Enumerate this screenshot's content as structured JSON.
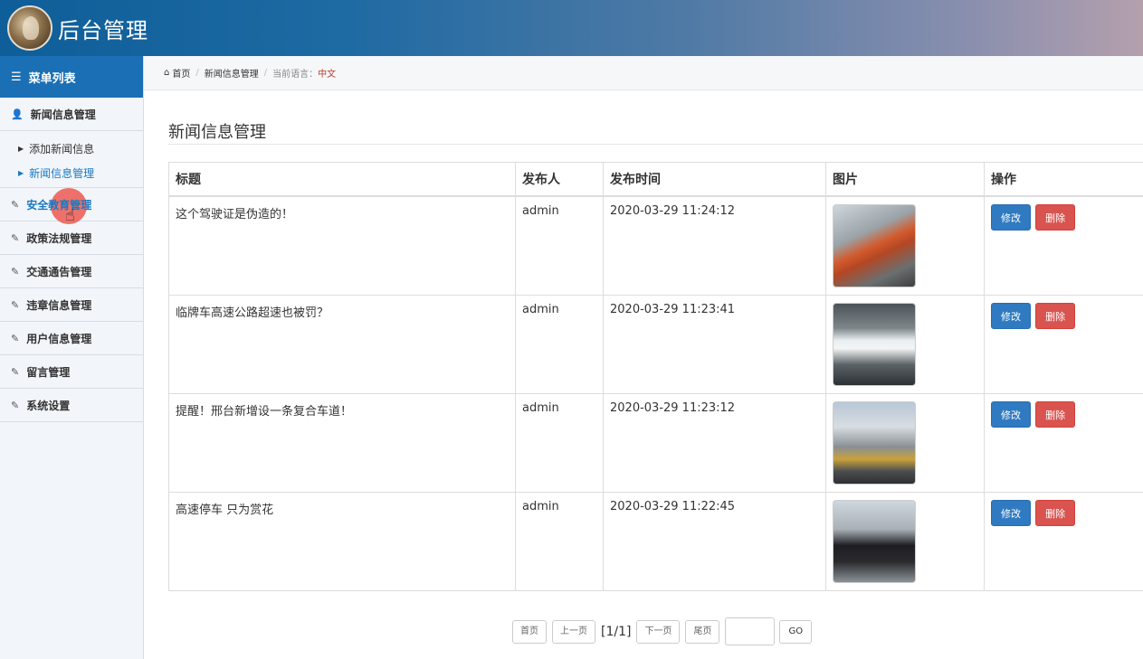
{
  "header": {
    "title": "后台管理",
    "avatar": "avatar-image"
  },
  "sidebar": {
    "menu_title": "菜单列表",
    "menu_icon": "list-icon",
    "group": {
      "title": "新闻信息管理",
      "icon": "user-icon",
      "items": [
        {
          "label": "添加新闻信息",
          "active": false
        },
        {
          "label": "新闻信息管理",
          "active": true
        }
      ]
    },
    "items": [
      {
        "label": "安全教育管理",
        "icon": "edit-icon"
      },
      {
        "label": "政策法规管理",
        "icon": "edit-icon"
      },
      {
        "label": "交通通告管理",
        "icon": "edit-icon"
      },
      {
        "label": "违章信息管理",
        "icon": "edit-icon"
      },
      {
        "label": "用户信息管理",
        "icon": "edit-icon"
      },
      {
        "label": "留言管理",
        "icon": "edit-icon"
      },
      {
        "label": "系统设置",
        "icon": "edit-icon"
      }
    ]
  },
  "breadcrumb": {
    "home": "首页",
    "section": "新闻信息管理",
    "lang_label": "当前语言：",
    "lang_value": "中文"
  },
  "main": {
    "title": "新闻信息管理",
    "table": {
      "headers": [
        "标题",
        "发布人",
        "发布时间",
        "图片",
        "操作"
      ],
      "rows": [
        {
          "title": "这个驾驶证是伪造的！",
          "publisher": "admin",
          "time": "2020-03-29 11:24:12",
          "image": "thumbnail-truck"
        },
        {
          "title": "临牌车高速公路超速也被罚？",
          "publisher": "admin",
          "time": "2020-03-29 11:23:41",
          "image": "thumbnail-tunnel-car"
        },
        {
          "title": "提醒！邢台新增设一条复合车道！",
          "publisher": "admin",
          "time": "2020-03-29 11:23:12",
          "image": "thumbnail-road-lane"
        },
        {
          "title": "高速停车 只为赏花",
          "publisher": "admin",
          "time": "2020-03-29 11:22:45",
          "image": "thumbnail-person-roadside"
        }
      ],
      "edit_label": "修改",
      "delete_label": "删除"
    }
  },
  "pagination": {
    "first": "首页",
    "prev": "上一页",
    "info": "[1/1]",
    "next": "下一页",
    "last": "尾页",
    "go": "GO"
  },
  "colors": {
    "header_start": "#0e5e99",
    "menu_head": "#1a6fb5",
    "active_link": "#1a78c2",
    "edit_button": "#2f7ac0",
    "delete_button": "#d9534f",
    "lang_highlight": "#c0392b"
  }
}
